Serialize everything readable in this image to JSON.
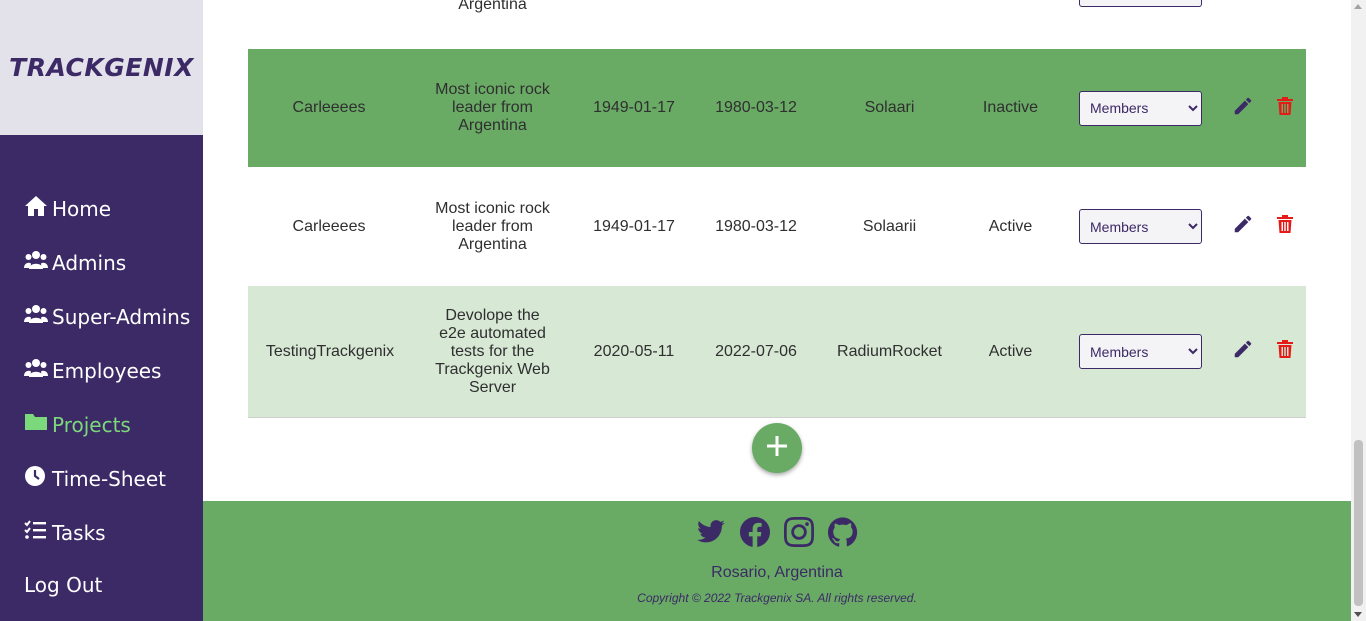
{
  "app": {
    "logo": "TRACKGENIX"
  },
  "sidebar": {
    "items": [
      {
        "label": "Home",
        "icon": "home-icon"
      },
      {
        "label": "Admins",
        "icon": "users-icon"
      },
      {
        "label": "Super-Admins",
        "icon": "users-icon"
      },
      {
        "label": "Employees",
        "icon": "users-icon"
      },
      {
        "label": "Projects",
        "icon": "folder-icon",
        "active": true
      },
      {
        "label": "Time-Sheet",
        "icon": "clock-icon"
      },
      {
        "label": "Tasks",
        "icon": "list-check-icon"
      },
      {
        "label": "Log Out",
        "icon": ""
      }
    ],
    "active_color": "#7bd97b",
    "bg_color": "#3c2a66"
  },
  "table": {
    "partial_row": {
      "description_tail": "Argentina"
    },
    "rows": [
      {
        "name": "Carleeees",
        "description": "Most iconic rock leader from Argentina",
        "start_date": "1949-01-17",
        "end_date": "1980-03-12",
        "client": "Solaari",
        "status": "Inactive",
        "members_select": "Members"
      },
      {
        "name": "Carleeees",
        "description": "Most iconic rock leader from Argentina",
        "start_date": "1949-01-17",
        "end_date": "1980-03-12",
        "client": "Solaarii",
        "status": "Active",
        "members_select": "Members"
      },
      {
        "name": "TestingTrackgenix",
        "description": "Devolope the e2e automated tests for the Trackgenix Web Server",
        "start_date": "2020-05-11",
        "end_date": "2022-07-06",
        "client": "RadiumRocket",
        "status": "Active",
        "members_select": "Members"
      }
    ],
    "row_colors": {
      "green": "#69aa65",
      "white": "#ffffff",
      "light": "#d7e8d5"
    }
  },
  "actions": {
    "add_icon": "plus-icon",
    "edit_icon": "pencil-icon",
    "delete_icon": "trash-icon"
  },
  "footer": {
    "social_icons": [
      "twitter-icon",
      "facebook-icon",
      "instagram-icon",
      "github-icon"
    ],
    "city": "Rosario, Argentina",
    "copyright": "Copyright © 2022 Trackgenix SA. All rights reserved."
  }
}
